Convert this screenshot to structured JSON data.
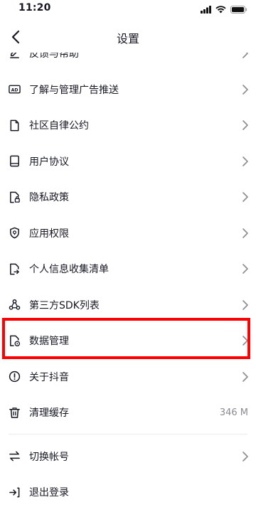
{
  "status_bar": {
    "time": "11:20"
  },
  "header": {
    "title": "设置"
  },
  "list": {
    "items": [
      {
        "label": "反馈与帮助"
      },
      {
        "label": "了解与管理广告推送"
      },
      {
        "label": "社区自律公约"
      },
      {
        "label": "用户协议"
      },
      {
        "label": "隐私政策"
      },
      {
        "label": "应用权限"
      },
      {
        "label": "个人信息收集清单"
      },
      {
        "label": "第三方SDK列表"
      },
      {
        "label": "数据管理"
      },
      {
        "label": "关于抖音"
      },
      {
        "label": "清理缓存",
        "value": "346 M"
      }
    ],
    "account_items": [
      {
        "label": "切换帐号"
      },
      {
        "label": "退出登录"
      }
    ]
  },
  "colors": {
    "highlight": "#ff0000",
    "text": "#161823",
    "secondary": "#8a8b91"
  }
}
